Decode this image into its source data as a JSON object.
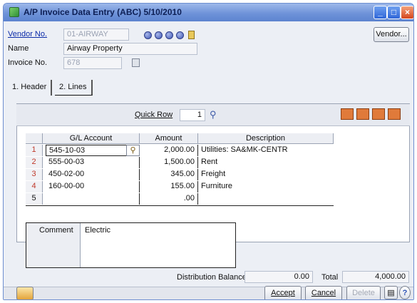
{
  "window": {
    "title": "A/P Invoice Data Entry (ABC) 5/10/2010"
  },
  "header": {
    "vendor_label": "Vendor No.",
    "vendor_value": "01-AIRWAY",
    "name_label": "Name",
    "name_value": "Airway Property",
    "invoice_label": "Invoice No.",
    "invoice_value": "678",
    "vendor_button": "Vendor..."
  },
  "tabs": [
    {
      "label": "1. Header"
    },
    {
      "label": "2. Lines"
    }
  ],
  "toolbar": {
    "quick_row_label": "Quick Row",
    "quick_row_value": "1"
  },
  "grid": {
    "columns": [
      "G/L Account",
      "Amount",
      "Description"
    ],
    "rows": [
      {
        "num": "1",
        "account": "545-10-03",
        "amount": "2,000.00",
        "description": "Utilities: SA&MK-CENTR"
      },
      {
        "num": "2",
        "account": "555-00-03",
        "amount": "1,500.00",
        "description": "Rent"
      },
      {
        "num": "3",
        "account": "450-02-00",
        "amount": "345.00",
        "description": "Freight"
      },
      {
        "num": "4",
        "account": "160-00-00",
        "amount": "155.00",
        "description": "Furniture"
      },
      {
        "num": "5",
        "account": "",
        "amount": ".00",
        "description": ""
      }
    ]
  },
  "comment": {
    "label": "Comment",
    "value": "Electric"
  },
  "totals": {
    "dist_label": "Distribution Balance",
    "dist_value": "0.00",
    "total_label": "Total",
    "total_value": "4,000.00"
  },
  "buttons": {
    "accept": "Accept",
    "cancel": "Cancel",
    "delete": "Delete"
  },
  "icons": {
    "app": "app-icon",
    "nav": [
      "first-record-icon",
      "previous-record-icon",
      "next-record-icon",
      "last-record-icon"
    ],
    "lookup": "magnifier-icon"
  },
  "colors": {
    "titlebar": "#6f93d9",
    "link": "#0a2aa8",
    "row_number": "#c0392b"
  }
}
